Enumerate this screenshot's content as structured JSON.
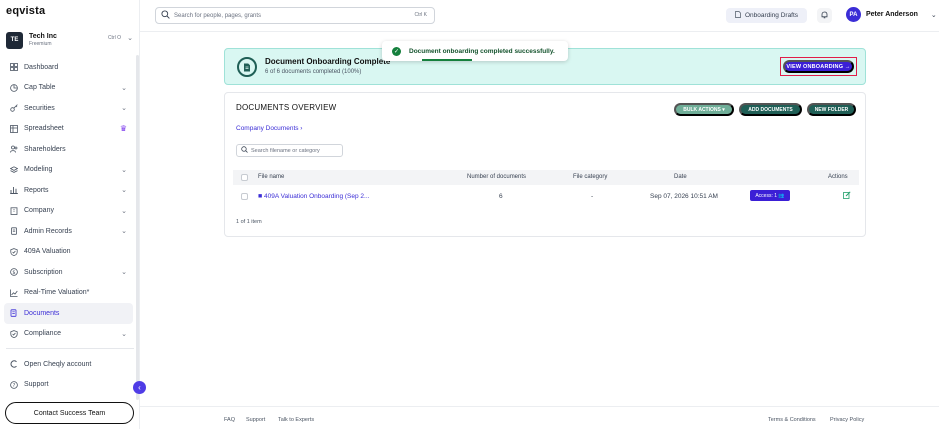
{
  "brand": {
    "logo": "eqvista"
  },
  "company": {
    "initials": "TE",
    "name": "Tech Inc",
    "plan": "Freemium",
    "shortcut": "Ctrl O"
  },
  "sidebar": {
    "items": [
      {
        "label": "Dashboard",
        "icon": "grid-icon",
        "chevron": false
      },
      {
        "label": "Cap Table",
        "icon": "pie-chart-icon",
        "chevron": true
      },
      {
        "label": "Securities",
        "icon": "key-icon",
        "chevron": true
      },
      {
        "label": "Spreadsheet",
        "icon": "table-icon",
        "chevron": false,
        "crown": true
      },
      {
        "label": "Shareholders",
        "icon": "users-icon",
        "chevron": false
      },
      {
        "label": "Modeling",
        "icon": "layers-icon",
        "chevron": true
      },
      {
        "label": "Reports",
        "icon": "bar-chart-icon",
        "chevron": true
      },
      {
        "label": "Company",
        "icon": "building-icon",
        "chevron": true
      },
      {
        "label": "Admin Records",
        "icon": "file-stack-icon",
        "chevron": true
      },
      {
        "label": "409A Valuation",
        "icon": "shield-check-icon",
        "chevron": false
      },
      {
        "label": "Subscription",
        "icon": "dollar-circle-icon",
        "chevron": true
      },
      {
        "label": "Real-Time Valuation*",
        "icon": "trend-line-icon",
        "chevron": false
      },
      {
        "label": "Documents",
        "icon": "documents-icon",
        "chevron": false,
        "active": true
      },
      {
        "label": "Compliance",
        "icon": "check-shield-icon",
        "chevron": true
      }
    ],
    "bottom_items": [
      {
        "label": "Open Cheqly account",
        "icon": "cheqly-icon"
      },
      {
        "label": "Support",
        "icon": "help-circle-icon"
      }
    ],
    "contact_label": "Contact Success Team"
  },
  "topbar": {
    "search_placeholder": "Search for people, pages, grants",
    "search_shortcut": "Ctrl K",
    "drafts_label": "Onboarding Drafts",
    "user_initials": "PA",
    "user_name": "Peter Anderson"
  },
  "toast": {
    "message": "Document onboarding completed successfully."
  },
  "banner": {
    "title": "Document Onboarding Complete",
    "subtitle": "6 of 6 documents completed (100%)",
    "button_label": "VIEW ONBOARDING →"
  },
  "documents": {
    "title": "DOCUMENTS OVERVIEW",
    "bulk_label": "BULK ACTIONS ▾",
    "add_label": "ADD DOCUMENTS",
    "folder_label": "NEW FOLDER",
    "breadcrumb": "Company Documents ›",
    "filter_placeholder": "Search filename or category",
    "columns": {
      "file_name": "File name",
      "count": "Number of documents",
      "category": "File category",
      "date": "Date",
      "actions": "Actions"
    },
    "rows": [
      {
        "name": "409A Valuation Onboarding (Sep 2...",
        "count": "6",
        "category": "-",
        "date": "Sep 07, 2026 10:51 AM",
        "access": "Access: 1 👥"
      }
    ],
    "item_count": "1 of 1 item"
  },
  "footer": {
    "faq": "FAQ",
    "support": "Support",
    "experts": "Talk to Experts",
    "terms": "Terms & Conditions",
    "privacy": "Privacy Policy"
  },
  "colors": {
    "accent": "#3b1fd6",
    "success": "#15803d",
    "banner_bg": "#d9f7f2",
    "dark_green": "#1f5f56"
  }
}
